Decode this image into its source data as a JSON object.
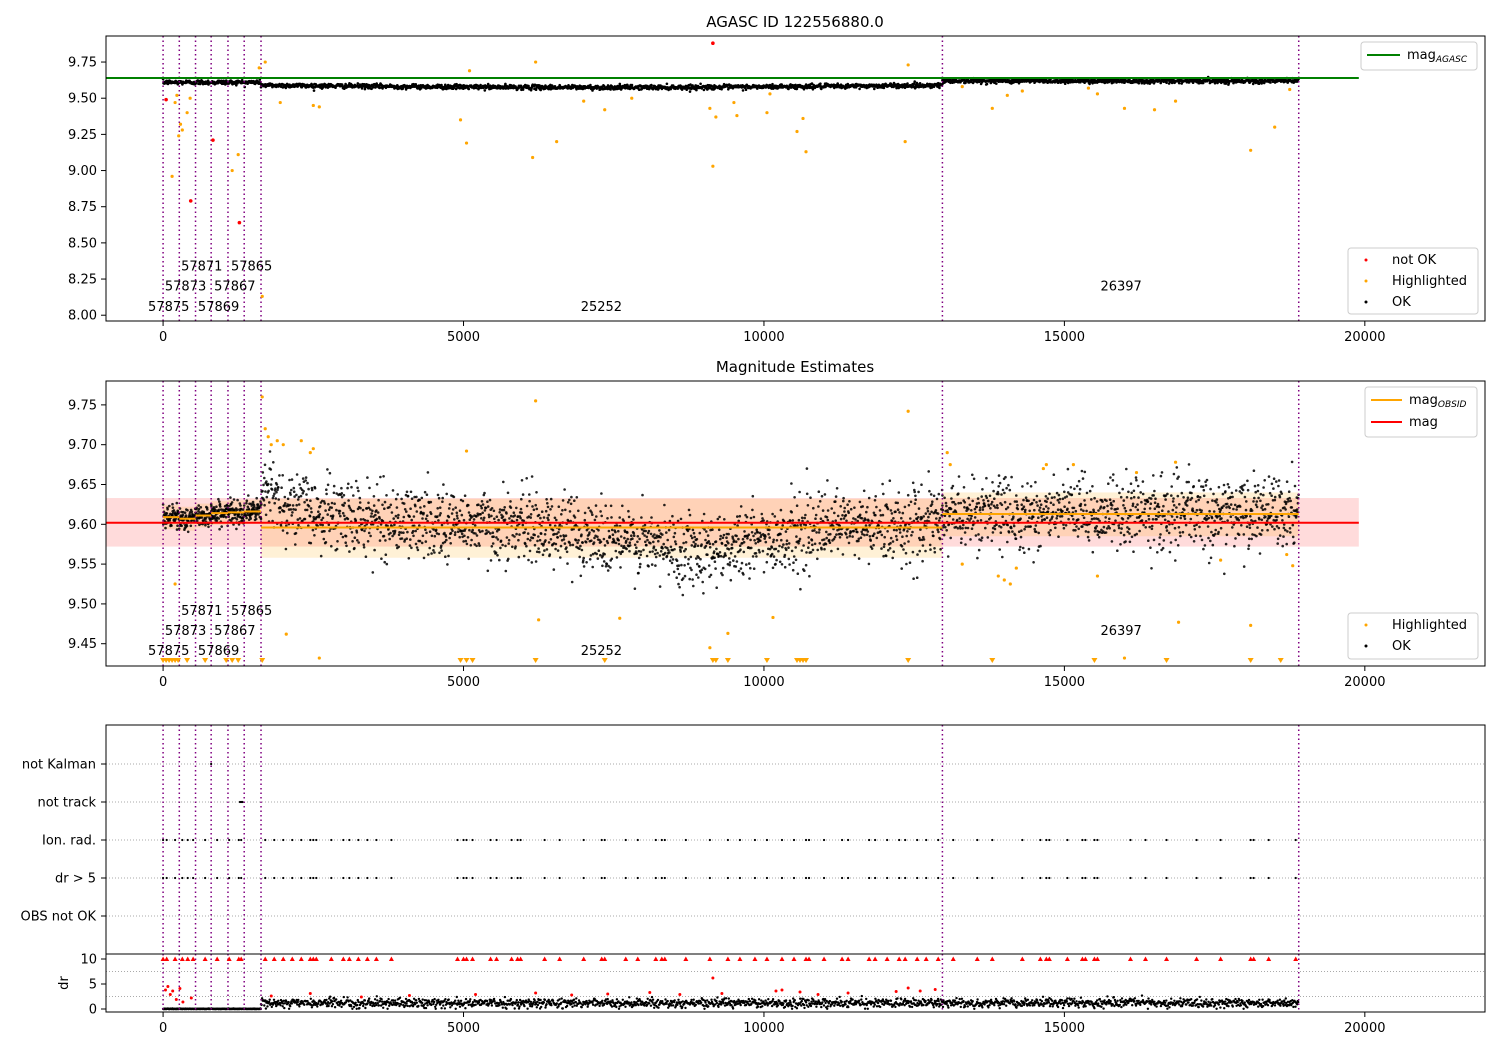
{
  "figure": {
    "background": "#ffffff"
  },
  "colors": {
    "ok": "#000000",
    "highlighted": "#ffa500",
    "not_ok": "#ff0000",
    "agasc_line": "#008000",
    "obsid_line": "#ffa500",
    "mag_line": "#ff0000",
    "obs_divider": "#800080"
  },
  "obs_boundaries": [
    0,
    270,
    540,
    800,
    1080,
    1350,
    1630,
    12970,
    18900
  ],
  "chart_data": [
    {
      "id": "agasc",
      "type": "scatter",
      "title": "AGASC ID 122556880.0",
      "xlim": [
        -950,
        22000
      ],
      "ylim": [
        7.96,
        9.93
      ],
      "xticks": [
        0,
        5000,
        10000,
        15000,
        20000
      ],
      "yticks": [
        8.0,
        8.25,
        8.5,
        8.75,
        9.0,
        9.25,
        9.5,
        9.75
      ],
      "lines": [
        {
          "name": "mag_AGASC",
          "label_main": "mag",
          "label_sub": "AGASC",
          "y": 9.64,
          "x": [
            -950,
            19900
          ],
          "color": "#008000"
        }
      ],
      "legend_lines_position": "upper-right",
      "legend_points_position": "lower-right",
      "legend_points": [
        {
          "label": "not OK",
          "color": "#ff0000"
        },
        {
          "label": "Highlighted",
          "color": "#ffa500"
        },
        {
          "label": "OK",
          "color": "#000000"
        }
      ],
      "obs_labels": [
        {
          "text": "57871",
          "x": 300,
          "y": 8.31
        },
        {
          "text": "57865",
          "x": 1130,
          "y": 8.31
        },
        {
          "text": "57873",
          "x": 30,
          "y": 8.17
        },
        {
          "text": "57867",
          "x": 850,
          "y": 8.17
        },
        {
          "text": "57875",
          "x": -250,
          "y": 8.03
        },
        {
          "text": "57869",
          "x": 580,
          "y": 8.03
        },
        {
          "text": "25252",
          "x": 6950,
          "y": 8.03
        },
        {
          "text": "26397",
          "x": 15600,
          "y": 8.17
        }
      ],
      "mean_segments": [
        {
          "x0": 0,
          "x1": 1630,
          "y": 9.61
        },
        {
          "x0": 1630,
          "x1": 12970,
          "y": 9.59
        },
        {
          "x0": 12970,
          "x1": 18900,
          "y": 9.62
        }
      ],
      "highlighted_points": [
        [
          150,
          8.96
        ],
        [
          200,
          9.47
        ],
        [
          230,
          9.52
        ],
        [
          260,
          9.24
        ],
        [
          290,
          9.32
        ],
        [
          320,
          9.28
        ],
        [
          400,
          9.4
        ],
        [
          450,
          9.5
        ],
        [
          1150,
          9.0
        ],
        [
          1250,
          9.11
        ],
        [
          1600,
          9.71
        ],
        [
          1650,
          8.13
        ],
        [
          1700,
          9.75
        ],
        [
          1950,
          9.47
        ],
        [
          2500,
          9.45
        ],
        [
          2600,
          9.44
        ],
        [
          4950,
          9.35
        ],
        [
          5050,
          9.19
        ],
        [
          5100,
          9.69
        ],
        [
          6150,
          9.09
        ],
        [
          6200,
          9.75
        ],
        [
          6550,
          9.2
        ],
        [
          7000,
          9.48
        ],
        [
          7350,
          9.42
        ],
        [
          7800,
          9.5
        ],
        [
          9100,
          9.43
        ],
        [
          9150,
          9.03
        ],
        [
          9200,
          9.37
        ],
        [
          9500,
          9.47
        ],
        [
          9550,
          9.38
        ],
        [
          10050,
          9.4
        ],
        [
          10100,
          9.53
        ],
        [
          10550,
          9.27
        ],
        [
          10650,
          9.36
        ],
        [
          10700,
          9.13
        ],
        [
          12350,
          9.2
        ],
        [
          12400,
          9.73
        ],
        [
          13300,
          9.58
        ],
        [
          13800,
          9.43
        ],
        [
          14050,
          9.52
        ],
        [
          14300,
          9.55
        ],
        [
          15400,
          9.57
        ],
        [
          15550,
          9.53
        ],
        [
          16000,
          9.43
        ],
        [
          16500,
          9.42
        ],
        [
          16850,
          9.48
        ],
        [
          18100,
          9.14
        ],
        [
          18500,
          9.3
        ],
        [
          18750,
          9.56
        ]
      ],
      "not_ok_points": [
        [
          50,
          9.49
        ],
        [
          460,
          8.79
        ],
        [
          830,
          9.21
        ],
        [
          1270,
          8.64
        ],
        [
          9150,
          9.88
        ]
      ]
    },
    {
      "id": "magest",
      "type": "scatter",
      "title": "Magnitude Estimates",
      "xlim": [
        -950,
        22000
      ],
      "ylim": [
        9.422,
        9.78
      ],
      "xticks": [
        0,
        5000,
        10000,
        15000,
        20000
      ],
      "yticks": [
        9.45,
        9.5,
        9.55,
        9.6,
        9.65,
        9.7,
        9.75
      ],
      "lines": [
        {
          "name": "mag_OBSID",
          "label_main": "mag",
          "label_sub": "OBSID",
          "color": "#ffa500"
        },
        {
          "name": "mag",
          "label_main": "mag",
          "label_sub": "",
          "y": 9.602,
          "band": [
            9.572,
            9.633
          ],
          "x": [
            -950,
            19900
          ],
          "color": "#ff0000"
        }
      ],
      "legend_lines_position": "upper-right",
      "legend_points_position": "lower-right",
      "legend_points": [
        {
          "label": "Highlighted",
          "color": "#ffa500"
        },
        {
          "label": "OK",
          "color": "#000000"
        }
      ],
      "obsid_segments": [
        {
          "x0": 0,
          "x1": 270,
          "y": 9.609,
          "band": [
            9.594,
            9.624
          ]
        },
        {
          "x0": 270,
          "x1": 540,
          "y": 9.607,
          "band": [
            9.592,
            9.622
          ]
        },
        {
          "x0": 540,
          "x1": 800,
          "y": 9.611,
          "band": [
            9.596,
            9.626
          ]
        },
        {
          "x0": 800,
          "x1": 1080,
          "y": 9.614,
          "band": [
            9.599,
            9.629
          ]
        },
        {
          "x0": 1080,
          "x1": 1350,
          "y": 9.615,
          "band": [
            9.6,
            9.63
          ]
        },
        {
          "x0": 1350,
          "x1": 1630,
          "y": 9.616,
          "band": [
            9.601,
            9.631
          ]
        },
        {
          "x0": 1630,
          "x1": 12970,
          "y": 9.596,
          "band": [
            9.558,
            9.632
          ]
        },
        {
          "x0": 12970,
          "x1": 18900,
          "y": 9.613,
          "band": [
            9.585,
            9.64
          ]
        }
      ],
      "obs_labels": [
        {
          "text": "57871",
          "x": 300,
          "y": 9.486
        },
        {
          "text": "57865",
          "x": 1130,
          "y": 9.486
        },
        {
          "text": "57873",
          "x": 30,
          "y": 9.461
        },
        {
          "text": "57867",
          "x": 850,
          "y": 9.461
        },
        {
          "text": "57875",
          "x": -250,
          "y": 9.436
        },
        {
          "text": "57869",
          "x": 580,
          "y": 9.436
        },
        {
          "text": "25252",
          "x": 6950,
          "y": 9.436
        },
        {
          "text": "26397",
          "x": 15600,
          "y": 9.461
        }
      ],
      "highlighted_points": [
        [
          200,
          9.525
        ],
        [
          1650,
          9.76
        ],
        [
          1700,
          9.72
        ],
        [
          1750,
          9.71
        ],
        [
          1800,
          9.7
        ],
        [
          1900,
          9.705
        ],
        [
          2000,
          9.7
        ],
        [
          2300,
          9.705
        ],
        [
          2450,
          9.69
        ],
        [
          2500,
          9.695
        ],
        [
          5050,
          9.692
        ],
        [
          6200,
          9.755
        ],
        [
          6250,
          9.48
        ],
        [
          7600,
          9.482
        ],
        [
          9100,
          9.445
        ],
        [
          9400,
          9.463
        ],
        [
          10150,
          9.483
        ],
        [
          12400,
          9.742
        ],
        [
          13050,
          9.69
        ],
        [
          13100,
          9.675
        ],
        [
          13300,
          9.55
        ],
        [
          13900,
          9.535
        ],
        [
          14000,
          9.53
        ],
        [
          14100,
          9.525
        ],
        [
          14200,
          9.545
        ],
        [
          14650,
          9.67
        ],
        [
          14700,
          9.675
        ],
        [
          15150,
          9.675
        ],
        [
          15550,
          9.535
        ],
        [
          16200,
          9.665
        ],
        [
          16850,
          9.678
        ],
        [
          16900,
          9.477
        ],
        [
          17600,
          9.555
        ],
        [
          18100,
          9.473
        ],
        [
          18700,
          9.562
        ],
        [
          18800,
          9.548
        ],
        [
          2050,
          9.462
        ],
        [
          2600,
          9.432
        ],
        [
          16000,
          9.432
        ]
      ],
      "low_markers_x": [
        0,
        50,
        100,
        150,
        200,
        250,
        400,
        700,
        1050,
        1150,
        1250,
        1650,
        4950,
        5050,
        5150,
        6200,
        7350,
        9150,
        9200,
        9400,
        10050,
        10550,
        10600,
        10650,
        10700,
        12400,
        13800,
        15500,
        16700,
        18100,
        18600
      ]
    },
    {
      "id": "flags",
      "type": "scatter",
      "xlim": [
        -950,
        22000
      ],
      "categories": [
        "not Kalman",
        "not track",
        "Ion. rad.",
        "dr > 5",
        "OBS not OK"
      ],
      "flag_points": {
        "not Kalman": [
          800
        ],
        "not track": [
          1280,
          1300,
          1320
        ],
        "Ion. rad.": [
          0,
          60,
          200,
          320,
          410,
          500,
          700,
          900,
          1100,
          1260,
          1300,
          1700,
          1850,
          2000,
          2150,
          2300,
          2450,
          2500,
          2550,
          2800,
          3000,
          3100,
          3250,
          3400,
          3550,
          3800,
          4900,
          5000,
          5050,
          5150,
          5450,
          5550,
          5800,
          5900,
          5950,
          6350,
          6600,
          7000,
          7300,
          7350,
          7700,
          7900,
          8200,
          8300,
          8350,
          8700,
          9100,
          9400,
          9600,
          9850,
          10050,
          10300,
          10500,
          10700,
          10750,
          11000,
          11300,
          11400,
          11750,
          11850,
          12050,
          12250,
          12350,
          12550,
          12700,
          12900,
          13150,
          13550,
          13800,
          14300,
          14600,
          14700,
          14750,
          15050,
          15300,
          15350,
          15500,
          15550,
          16100,
          16350,
          16700,
          17200,
          17600,
          18100,
          18150,
          18400,
          18850
        ],
        "dr > 5": [
          0,
          60,
          200,
          320,
          410,
          500,
          700,
          900,
          1100,
          1260,
          1300,
          1700,
          1850,
          2000,
          2150,
          2300,
          2450,
          2500,
          2550,
          2800,
          3000,
          3100,
          3250,
          3400,
          3550,
          3800,
          4900,
          5000,
          5050,
          5150,
          5450,
          5550,
          5800,
          5900,
          5950,
          6350,
          6600,
          7000,
          7300,
          7350,
          7700,
          7900,
          8200,
          8300,
          8350,
          8700,
          9100,
          9400,
          9600,
          9850,
          10050,
          10300,
          10500,
          10700,
          10750,
          11000,
          11300,
          11400,
          11750,
          11850,
          12050,
          12250,
          12350,
          12550,
          12700,
          12900,
          13150,
          13550,
          13800,
          14300,
          14600,
          14700,
          14750,
          15050,
          15300,
          15350,
          15500,
          15550,
          16100,
          16350,
          16700,
          17200,
          17600,
          18100,
          18150,
          18400,
          18850
        ],
        "OBS not OK": []
      }
    },
    {
      "id": "dr",
      "type": "scatter",
      "ylabel": "dr",
      "xlim": [
        -950,
        22000
      ],
      "ylim": [
        -0.6,
        11
      ],
      "xticks": [
        0,
        5000,
        10000,
        15000,
        20000
      ],
      "yticks": [
        0,
        5,
        10
      ],
      "red_points": [
        [
          40,
          3.8
        ],
        [
          80,
          4.5
        ],
        [
          120,
          2.9
        ],
        [
          160,
          3.6
        ],
        [
          220,
          1.9
        ],
        [
          280,
          4.1
        ],
        [
          330,
          1.4
        ],
        [
          470,
          2.2
        ],
        [
          9150,
          6.2
        ],
        [
          1800,
          2.6
        ],
        [
          2450,
          3.1
        ],
        [
          3300,
          2.4
        ],
        [
          4100,
          2.7
        ],
        [
          5200,
          2.9
        ],
        [
          6200,
          3.2
        ],
        [
          6800,
          2.8
        ],
        [
          7400,
          3.0
        ],
        [
          8100,
          3.3
        ],
        [
          8600,
          2.9
        ],
        [
          9300,
          3.1
        ],
        [
          10200,
          3.6
        ],
        [
          10300,
          3.8
        ],
        [
          10600,
          3.4
        ],
        [
          10900,
          2.9
        ],
        [
          11400,
          3.2
        ],
        [
          12200,
          3.5
        ],
        [
          12400,
          4.2
        ],
        [
          12600,
          3.6
        ],
        [
          12850,
          3.9
        ]
      ],
      "red_top_x": [
        0,
        60,
        200,
        320,
        410,
        500,
        700,
        900,
        1100,
        1260,
        1300,
        1700,
        1850,
        2000,
        2150,
        2300,
        2450,
        2500,
        2550,
        2800,
        3000,
        3100,
        3250,
        3400,
        3550,
        3800,
        4900,
        5000,
        5050,
        5150,
        5450,
        5550,
        5800,
        5900,
        5950,
        6350,
        6600,
        7000,
        7300,
        7350,
        7700,
        7900,
        8200,
        8300,
        8350,
        8700,
        9100,
        9400,
        9600,
        9850,
        10050,
        10300,
        10500,
        10700,
        10750,
        11000,
        11300,
        11400,
        11750,
        11850,
        12050,
        12250,
        12350,
        12550,
        12700,
        12900,
        13150,
        13550,
        13800,
        14300,
        14600,
        14700,
        14750,
        15050,
        15300,
        15350,
        15500,
        15550,
        16100,
        16350,
        16700,
        17200,
        17600,
        18100,
        18150,
        18400,
        18850
      ]
    }
  ]
}
